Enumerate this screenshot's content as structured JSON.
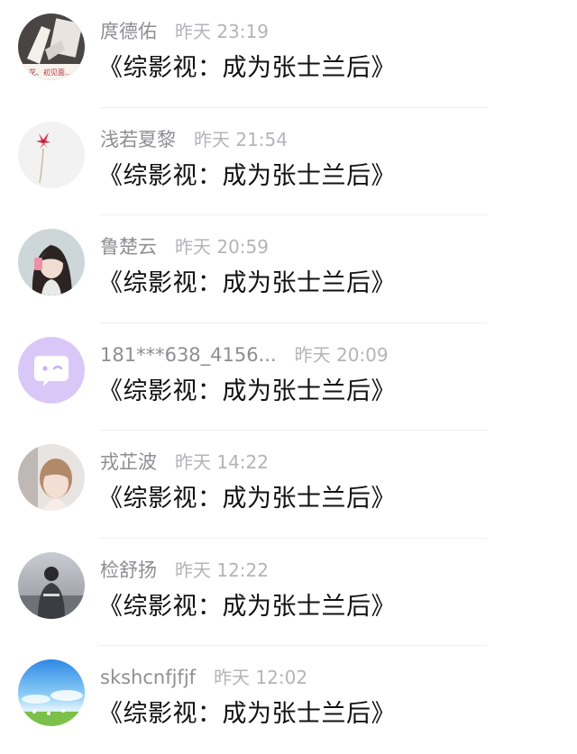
{
  "messages": [
    {
      "name": "庹德佑",
      "time": "昨天 23:19",
      "text": "《综影视：成为张士兰后》",
      "avatar": "photo-hands-notebook",
      "avatar_caption": "花、初见面..."
    },
    {
      "name": "浅若夏黎",
      "time": "昨天 21:54",
      "text": "《综影视：成为张士兰后》",
      "avatar": "red-flower"
    },
    {
      "name": "鲁楚云",
      "time": "昨天 20:59",
      "text": "《综影视：成为张士兰后》",
      "avatar": "girl-portrait"
    },
    {
      "name": "181***638_4156...",
      "time": "昨天 20:09",
      "text": "《综影视：成为张士兰后》",
      "avatar": "default-chat-bubble-icon"
    },
    {
      "name": "戎芷波",
      "time": "昨天 14:22",
      "text": "《综影视：成为张士兰后》",
      "avatar": "child-portrait"
    },
    {
      "name": "检舒扬",
      "time": "昨天 12:22",
      "text": "《综影视：成为张士兰后》",
      "avatar": "person-back-view"
    },
    {
      "name": "skshcnfjfjf",
      "time": "昨天 12:02",
      "text": "《综影视：成为张士兰后》",
      "avatar": "sky-landscape"
    }
  ],
  "colors": {
    "name": "#8e8e93",
    "time": "#b4b4b9",
    "message": "#111111",
    "default_avatar_bg": "#d9c8f7"
  }
}
